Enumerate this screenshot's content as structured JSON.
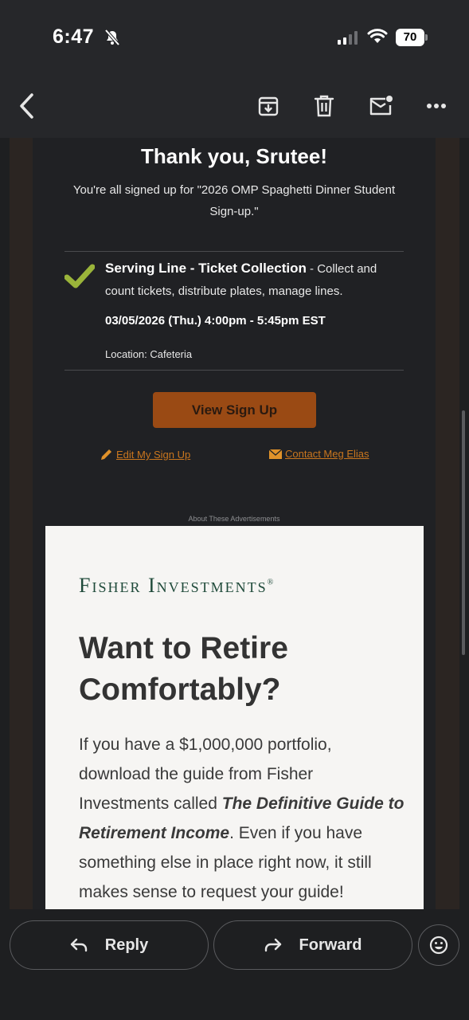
{
  "status_bar": {
    "time": "6:47",
    "battery": "70"
  },
  "toolbar": {
    "back_icon": "chevron-left-icon",
    "archive_icon": "archive-icon",
    "delete_icon": "trash-icon",
    "unread_icon": "mark-unread-icon",
    "more_icon": "more-horizontal-icon"
  },
  "email": {
    "heading": "Thank you, Srutee!",
    "signed_up_text": "You're all signed up for \"2026 OMP Spaghetti Dinner Student Sign-up.\"",
    "slot": {
      "title": "Serving Line - Ticket Collection",
      "description": " - Collect and count tickets, distribute plates, manage lines.",
      "datetime": "03/05/2026 (Thu.) 4:00pm - 5:45pm EST",
      "location": "Location: Cafeteria"
    },
    "view_button": "View Sign Up",
    "edit_link": "Edit My Sign Up",
    "contact_link": "Contact Meg Elias",
    "ads_label": "About These Advertisements"
  },
  "ad": {
    "brand": "Fisher Investments",
    "brand_mark": "®",
    "headline": "Want to Retire Comfortably?",
    "body_1": "If you have a $1,000,000 portfolio, download the guide from Fisher Investments called ",
    "body_bold": "The Definitive Guide to Retirement Income",
    "body_2": ". Even if you have something else in place right now, it still makes sense to request your guide!"
  },
  "bottom_bar": {
    "reply_label": "Reply",
    "forward_label": "Forward"
  },
  "colors": {
    "accent_button": "#9a4a14",
    "link": "#c9761e",
    "check": "#9ab43a",
    "brand_green": "#1f4a3a"
  }
}
